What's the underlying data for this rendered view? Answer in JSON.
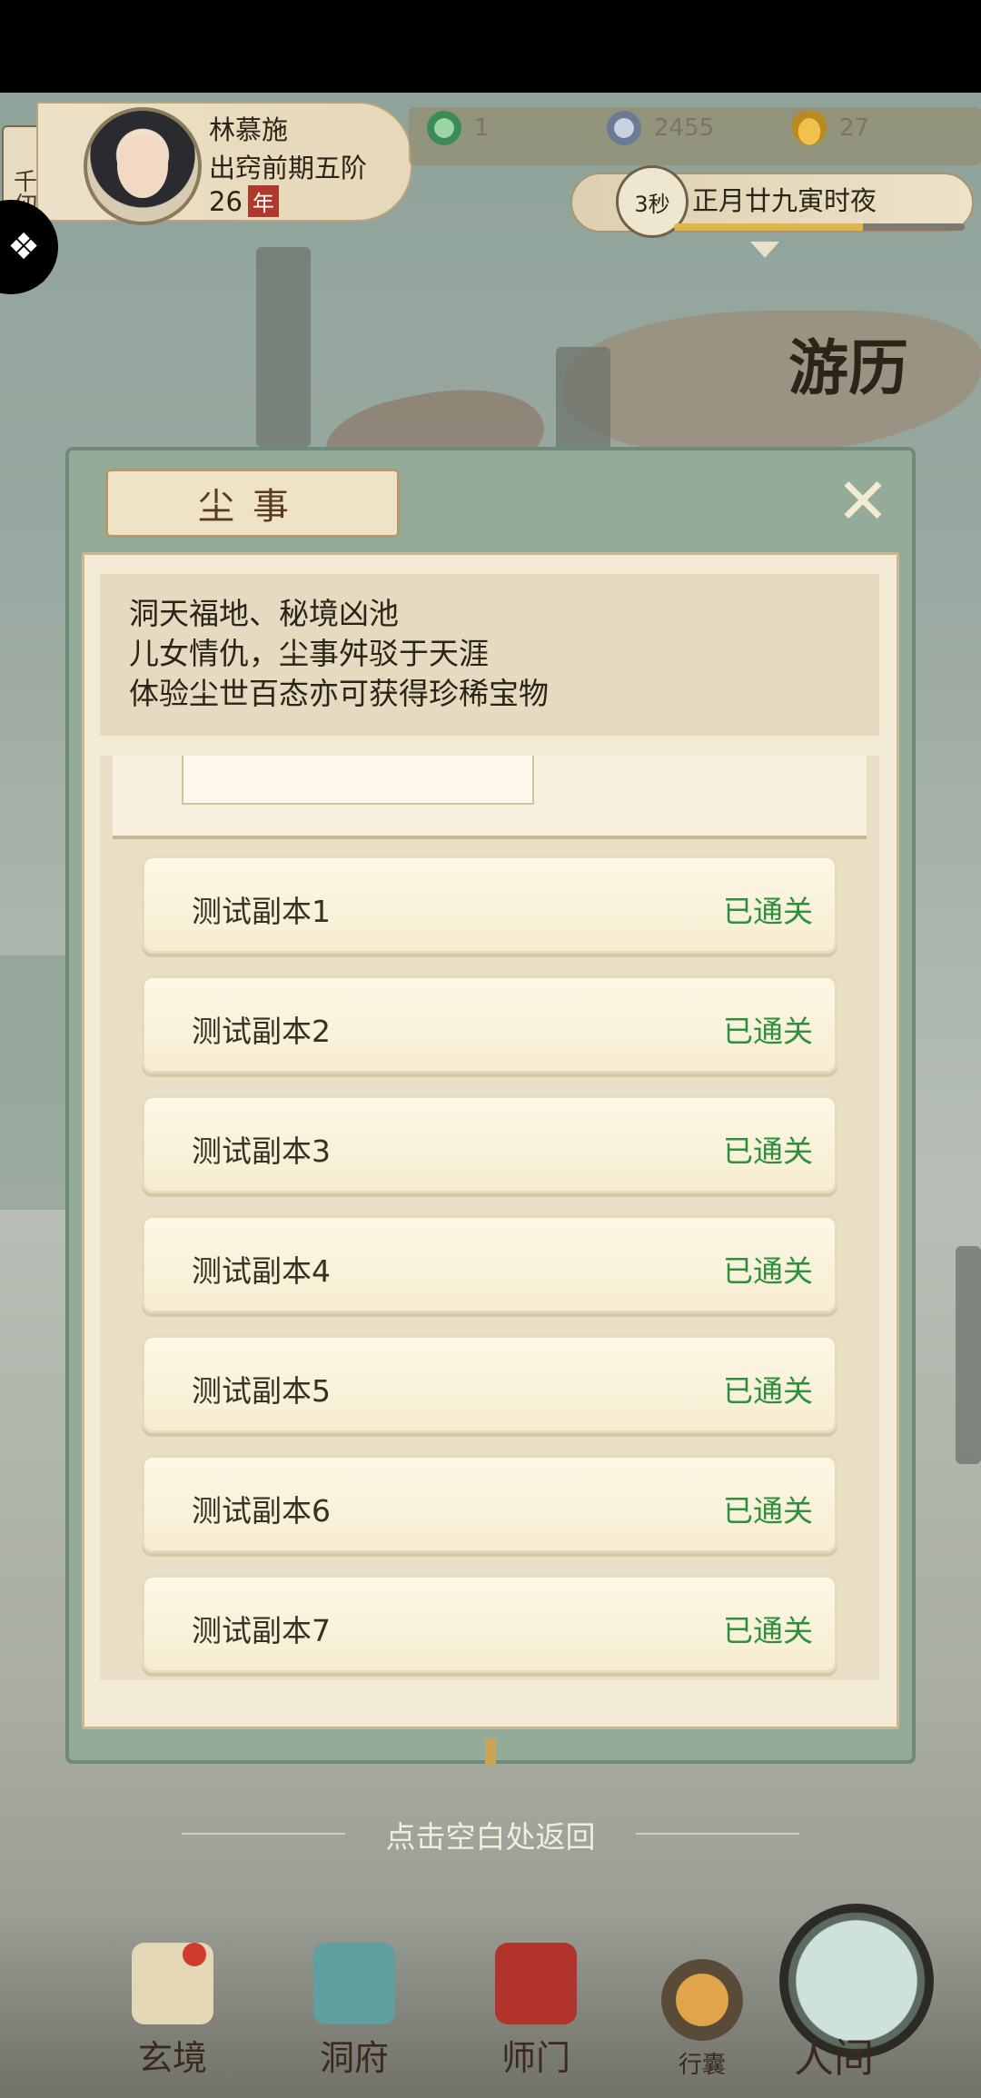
{
  "hud": {
    "sect_tab": "千仞居",
    "player_name": "林慕施",
    "player_rank": "出窍前期五阶",
    "player_age": "26",
    "player_age_unit": "年",
    "resources": [
      {
        "icon": "jade-icon",
        "value": "1"
      },
      {
        "icon": "coin-icon",
        "value": "2455"
      },
      {
        "icon": "ingot-icon",
        "value": "27"
      }
    ],
    "timer": "3秒",
    "date_text": "正月廿九寅时夜",
    "time_progress": 0.65
  },
  "map": {
    "travel_label": "游历"
  },
  "modal": {
    "title": "尘事",
    "intro_lines": [
      "洞天福地、秘境凶池",
      "儿女情仇，尘事舛驳于天涯",
      "体验尘世百态亦可获得珍稀宝物"
    ],
    "rows": [
      {
        "name": "测试副本1",
        "status": "已通关"
      },
      {
        "name": "测试副本2",
        "status": "已通关"
      },
      {
        "name": "测试副本3",
        "status": "已通关"
      },
      {
        "name": "测试副本4",
        "status": "已通关"
      },
      {
        "name": "测试副本5",
        "status": "已通关"
      },
      {
        "name": "测试副本6",
        "status": "已通关"
      },
      {
        "name": "测试副本7",
        "status": "已通关"
      }
    ],
    "back_hint": "点击空白处返回"
  },
  "nav": {
    "items": [
      "玄境",
      "洞府",
      "师门",
      "行囊",
      "人间"
    ]
  },
  "colors": {
    "status_green": "#2e8f3c",
    "panel_green": "#93ab98",
    "age_badge": "#b0392e"
  }
}
